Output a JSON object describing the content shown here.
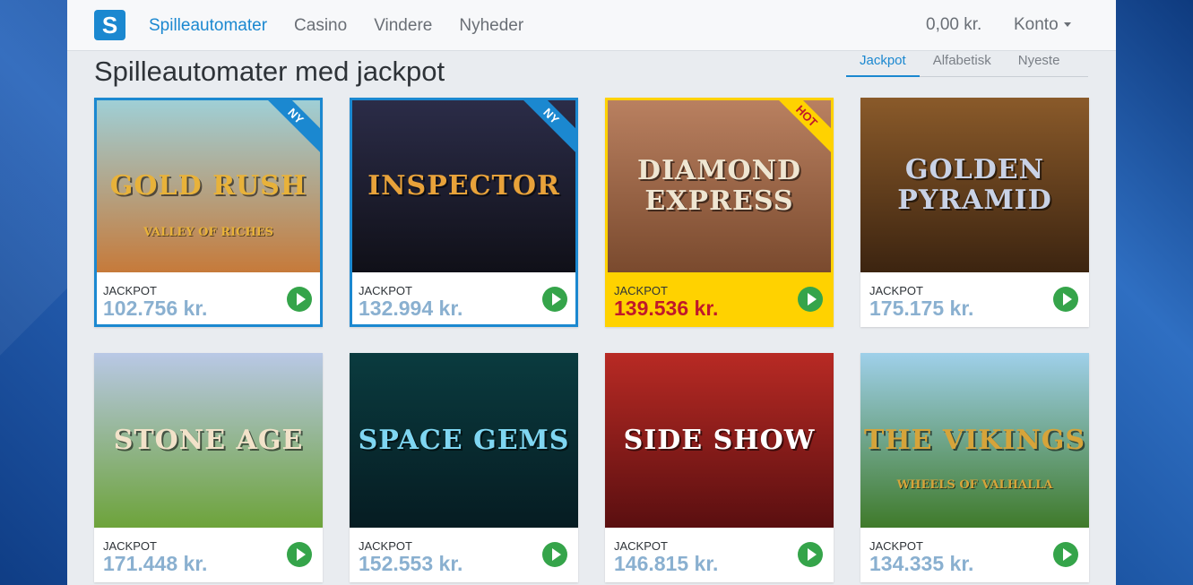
{
  "header": {
    "logo": "S",
    "nav": [
      "Spilleautomater",
      "Casino",
      "Vindere",
      "Nyheder"
    ],
    "balance": "0,00 kr.",
    "account": "Konto"
  },
  "page_title": "Spilleautomater med jackpot",
  "sort_tabs": [
    "Jackpot",
    "Alfabetisk",
    "Nyeste"
  ],
  "games": [
    {
      "title": "GOLD RUSH",
      "subtitle": "VALLEY OF RICHES",
      "badge": "NY",
      "jackpot_label": "JACKPOT",
      "jackpot": "102.756 kr.",
      "colors": [
        "#9fcfd6",
        "#c67a3a"
      ],
      "title_color": "#e8b23a"
    },
    {
      "title": "INSPECTOR",
      "subtitle": "",
      "badge": "NY",
      "jackpot_label": "JACKPOT",
      "jackpot": "132.994 kr.",
      "colors": [
        "#2b2c48",
        "#101018"
      ],
      "title_color": "#e8a23a"
    },
    {
      "title": "DIAMOND EXPRESS",
      "subtitle": "",
      "badge": "HOT",
      "jackpot_label": "JACKPOT",
      "jackpot": "139.536 kr.",
      "colors": [
        "#b98060",
        "#7a4a2e"
      ],
      "title_color": "#efe6d2"
    },
    {
      "title": "GOLDEN PYRAMID",
      "subtitle": "",
      "badge": "",
      "jackpot_label": "JACKPOT",
      "jackpot": "175.175 kr.",
      "colors": [
        "#8a5a2a",
        "#3c2410"
      ],
      "title_color": "#c9d2e6"
    },
    {
      "title": "STONE AGE",
      "subtitle": "",
      "badge": "",
      "jackpot_label": "JACKPOT",
      "jackpot": "171.448 kr.",
      "colors": [
        "#b9c8e6",
        "#6da33a"
      ],
      "title_color": "#f2e2c9"
    },
    {
      "title": "SPACE GEMS",
      "subtitle": "",
      "badge": "",
      "jackpot_label": "JACKPOT",
      "jackpot": "152.553 kr.",
      "colors": [
        "#0a3b3f",
        "#061c22"
      ],
      "title_color": "#7fd6f2"
    },
    {
      "title": "SIDE SHOW",
      "subtitle": "",
      "badge": "",
      "jackpot_label": "JACKPOT",
      "jackpot": "146.815 kr.",
      "colors": [
        "#b82a24",
        "#5a0f10"
      ],
      "title_color": "#ffffff"
    },
    {
      "title": "THE VIKINGS",
      "subtitle": "WHEELS OF VALHALLA",
      "badge": "",
      "jackpot_label": "JACKPOT",
      "jackpot": "134.335 kr.",
      "colors": [
        "#9fd0ea",
        "#3f7a2a"
      ],
      "title_color": "#d6a43a"
    }
  ]
}
